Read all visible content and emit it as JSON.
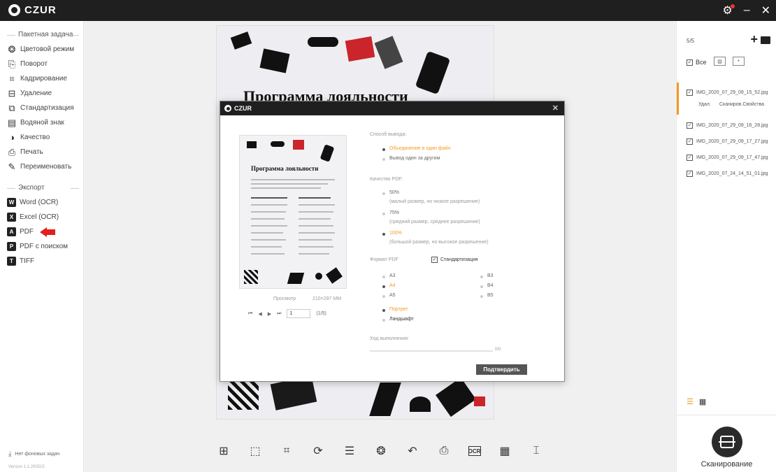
{
  "app": {
    "title": "CZUR"
  },
  "sidebar": {
    "batch_header": "Пакетная задача",
    "batch_items": [
      {
        "label": "Цветовой режим",
        "icon": "palette-icon"
      },
      {
        "label": "Поворот",
        "icon": "rotate-icon"
      },
      {
        "label": "Кадрирование",
        "icon": "crop-icon"
      },
      {
        "label": "Удаление",
        "icon": "delete-icon"
      },
      {
        "label": "Стандартизация",
        "icon": "standardize-icon"
      },
      {
        "label": "Водяной знак",
        "icon": "watermark-icon"
      },
      {
        "label": "Качество",
        "icon": "quality-icon"
      },
      {
        "label": "Печать",
        "icon": "printer-icon"
      },
      {
        "label": "Переименовать",
        "icon": "rename-icon"
      }
    ],
    "export_header": "Экспорт",
    "export_items": [
      {
        "label": "Word (OCR)",
        "icon": "word-icon",
        "glyph": "W"
      },
      {
        "label": "Excel (OCR)",
        "icon": "excel-icon",
        "glyph": "X"
      },
      {
        "label": "PDF",
        "icon": "pdf-icon",
        "glyph": "A"
      },
      {
        "label": "PDF с поиском",
        "icon": "pdf-search-icon",
        "glyph": "P"
      },
      {
        "label": "TIFF",
        "icon": "tiff-icon",
        "glyph": "T"
      }
    ],
    "footer": "Нет фоновых задач",
    "version": "Version 1.1.200515"
  },
  "page": {
    "heading": "Программа лояльности"
  },
  "toolbar": {
    "icons": [
      "fit-icon",
      "select-icon",
      "crop-icon",
      "rotate-crop-icon",
      "adjust-icon",
      "color-icon",
      "undo-icon",
      "print-icon",
      "ocr-icon",
      "qr-icon",
      "split-icon"
    ],
    "ocr_label": "OCR"
  },
  "right_panel": {
    "count": "5/5",
    "select_all": "Все",
    "files": [
      "IMG_2020_07_29_09_15_52.jpg",
      "IMG_2020_07_29_09_16_28.jpg",
      "IMG_2020_07_29_09_17_27.jpg",
      "IMG_2020_07_29_09_17_47.jpg",
      "IMG_2020_07_24_14_51_01.jpg"
    ],
    "actions": {
      "delete": "Удал.",
      "scan": "Сканиров.",
      "props": "Свойства"
    },
    "scan_label": "Сканирование"
  },
  "dialog": {
    "title": "CZUR",
    "preview_label": "Просмотр",
    "preview_size": "210×297 MM",
    "page_input": "1",
    "page_total": "(1/5)",
    "thumb_title": "Программа лояльности",
    "output_label": "Способ вывода:",
    "output_options": [
      {
        "label": "Объединение в один файл",
        "selected": true
      },
      {
        "label": "Вывод один за другим",
        "selected": false
      }
    ],
    "quality_label": "Качество PDF:",
    "quality_options": [
      {
        "label": "50%",
        "sub": "(малый размер, но низкое разрешение)",
        "selected": false
      },
      {
        "label": "75%",
        "sub": "(средний размер, среднее разрешение)",
        "selected": false
      },
      {
        "label": "100%",
        "sub": "(большой размер, но высокое разрешение)",
        "selected": true
      }
    ],
    "format_label": "Формат PDF",
    "standardize": "Стандартизация",
    "sizes_left": [
      {
        "label": "A3",
        "selected": false
      },
      {
        "label": "A4",
        "selected": true
      },
      {
        "label": "A5",
        "selected": false
      }
    ],
    "sizes_right": [
      {
        "label": "B3",
        "selected": false
      },
      {
        "label": "B4",
        "selected": false
      },
      {
        "label": "B5",
        "selected": false
      }
    ],
    "orientation": [
      {
        "label": "Портрет",
        "selected": true
      },
      {
        "label": "Ландшафт",
        "selected": false
      }
    ],
    "progress_label": "Ход выполнения:",
    "progress_value": "0/0",
    "confirm": "Подтвердить"
  },
  "colors": {
    "accent": "#f39a1f",
    "titlebar": "#1f1f1f",
    "red_arrow": "#e21e1e"
  }
}
